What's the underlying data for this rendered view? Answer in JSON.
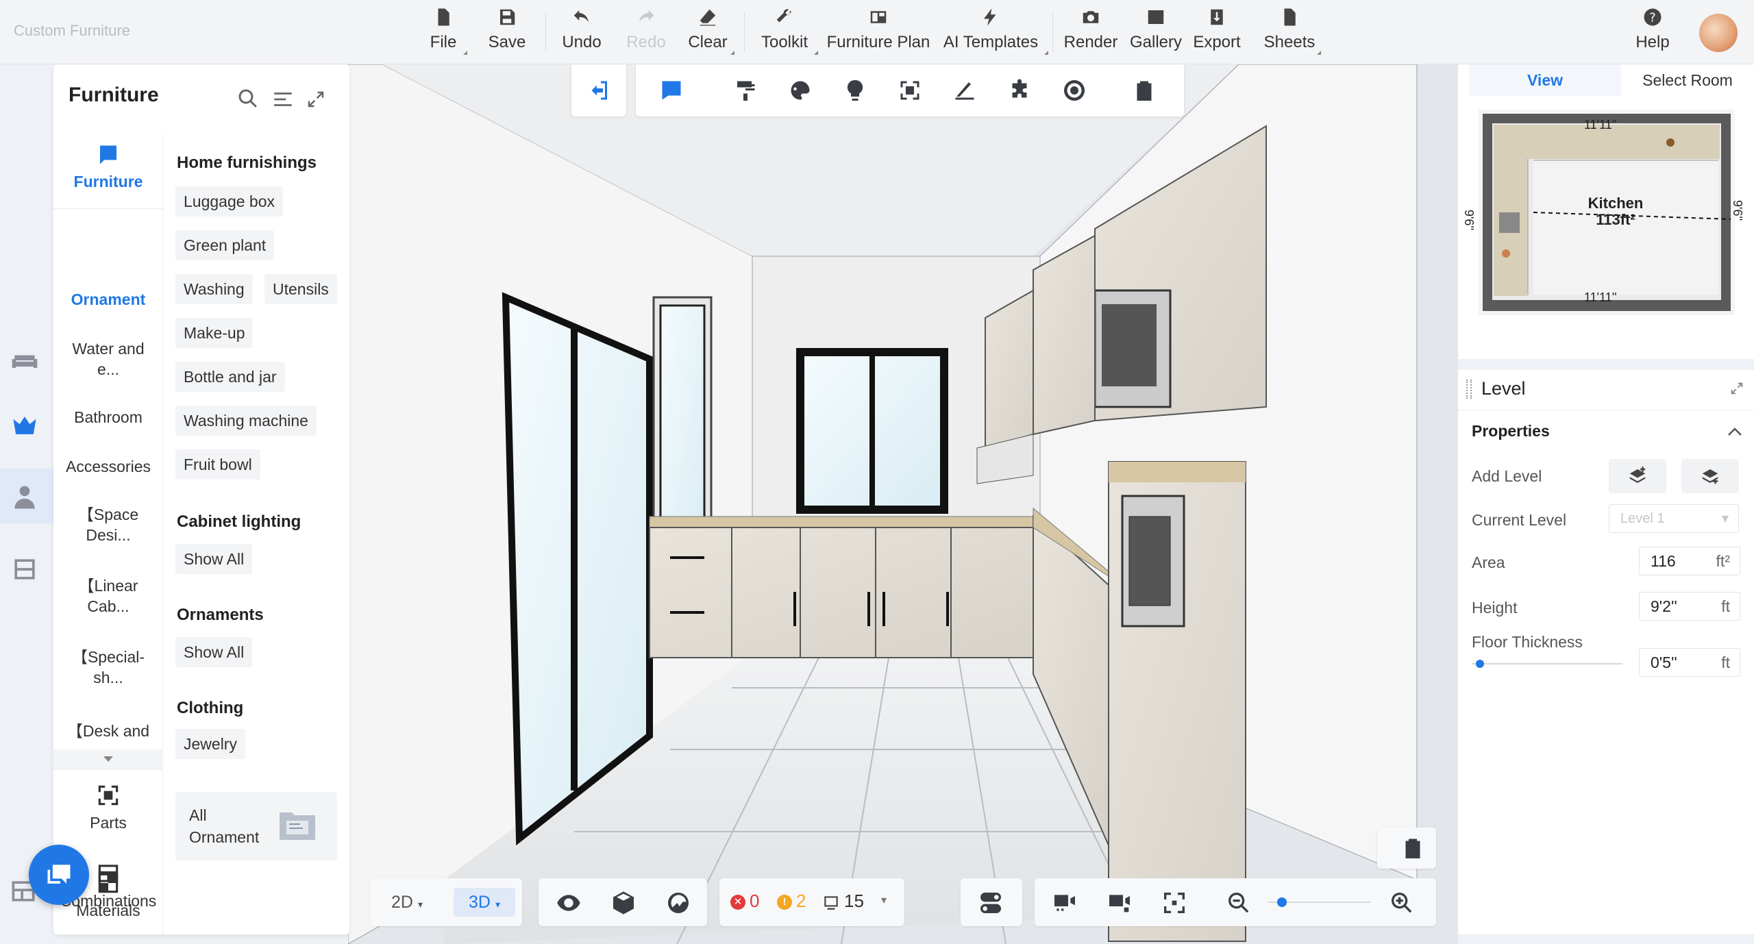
{
  "app": {
    "title": "Custom Furniture"
  },
  "toolbar": {
    "file": "File",
    "save": "Save",
    "undo": "Undo",
    "redo": "Redo",
    "clear": "Clear",
    "toolkit": "Toolkit",
    "furniture_plan": "Furniture Plan",
    "ai_templates": "AI Templates",
    "render": "Render",
    "gallery": "Gallery",
    "export": "Export",
    "sheets": "Sheets",
    "help": "Help"
  },
  "furniture_panel": {
    "title": "Furniture",
    "categories": [
      {
        "label": "Furniture"
      },
      {
        "label": "Ornament"
      },
      {
        "label": "Water and e..."
      },
      {
        "label": "Bathroom"
      },
      {
        "label": "Accessories"
      },
      {
        "label": "【Space Desi..."
      },
      {
        "label": "【Linear Cab..."
      },
      {
        "label": "【Special-sh..."
      },
      {
        "label": "【Desk and"
      }
    ],
    "tools": [
      {
        "label": "Parts"
      },
      {
        "label": "Combinations"
      },
      {
        "label": "Materials"
      }
    ],
    "sections": {
      "home": {
        "title": "Home furnishings",
        "items": [
          "Luggage box",
          "Green plant",
          "Washing",
          "Utensils",
          "Make-up",
          "Bottle and jar",
          "Washing machine",
          "Fruit bowl"
        ]
      },
      "cabinet": {
        "title": "Cabinet lighting",
        "items": [
          "Show All"
        ]
      },
      "ornaments": {
        "title": "Ornaments",
        "items": [
          "Show All"
        ]
      },
      "clothing": {
        "title": "Clothing",
        "items": [
          "Jewelry"
        ]
      }
    },
    "all_ornament": "All Ornament"
  },
  "right_panel": {
    "tabs": {
      "view": "View",
      "select_room": "Select Room"
    },
    "minimap": {
      "room_name": "Kitchen",
      "room_area": "113ft²",
      "dim_top": "11'11''",
      "dim_bottom": "11'11''",
      "dim_left": "9'6''",
      "dim_right": "9'6''"
    },
    "level": {
      "title": "Level",
      "properties": "Properties",
      "add_level": "Add Level",
      "current_level": "Current Level",
      "current_level_value": "Level 1",
      "area": "Area",
      "area_value": "116",
      "area_unit": "ft²",
      "height": "Height",
      "height_value": "9'2''",
      "height_unit": "ft",
      "floor_thickness": "Floor Thickness",
      "floor_thickness_value": "0'5''",
      "floor_thickness_unit": "ft",
      "floor_thickness_slider": 0.03
    }
  },
  "bottom_bar": {
    "mode_2d": "2D",
    "mode_3d": "3D",
    "errors": "0",
    "warnings": "2",
    "items": "15",
    "zoom": 0.1
  },
  "colors": {
    "accent": "#1f78e6",
    "error": "#e23b3b",
    "warning": "#f5a623"
  }
}
